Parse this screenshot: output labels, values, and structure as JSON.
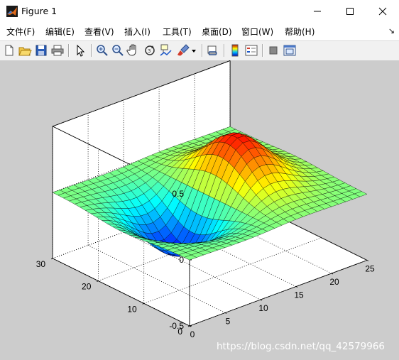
{
  "window": {
    "title": "Figure 1",
    "title_icon": "matlab-logo-icon"
  },
  "menu": {
    "items": [
      {
        "label": "文件(F)"
      },
      {
        "label": "编辑(E)"
      },
      {
        "label": "查看(V)"
      },
      {
        "label": "插入(I)"
      },
      {
        "label": "工具(T)"
      },
      {
        "label": "桌面(D)"
      },
      {
        "label": "窗口(W)"
      },
      {
        "label": "帮助(H)"
      }
    ],
    "overflow_icon": "dock-arrow-icon"
  },
  "toolbar": {
    "buttons": [
      "new-figure-icon",
      "open-file-icon",
      "save-icon",
      "print-icon",
      "select-arrow-icon",
      "zoom-in-icon",
      "zoom-out-icon",
      "pan-hand-icon",
      "rotate-3d-icon",
      "data-cursor-icon",
      "brush-icon",
      "brush-dropdown-icon",
      "link-plot-icon",
      "colorbar-icon",
      "legend-icon",
      "hide-plot-tools-icon",
      "show-plot-tools-icon"
    ]
  },
  "chart_data": {
    "type": "surface",
    "function": "peaks-like dipole surface, z = sin-shaped positive lobe and negative lobe",
    "x_ticks": [
      "0",
      "5",
      "10",
      "15",
      "20",
      "25"
    ],
    "y_ticks": [
      "0",
      "10",
      "20",
      "30"
    ],
    "z_ticks": [
      "0.5",
      "0",
      "-0.5"
    ],
    "xlim": [
      0,
      25
    ],
    "ylim": [
      0,
      30
    ],
    "zlim": [
      -0.5,
      0.5
    ],
    "grid": true,
    "colormap": "jet"
  },
  "watermark": "https://blog.csdn.net/qq_42579966",
  "colors": {
    "figure_bg": "#cccccc",
    "axes_bg": "#ffffff",
    "toolbar_bg": "#f1f1f1"
  }
}
